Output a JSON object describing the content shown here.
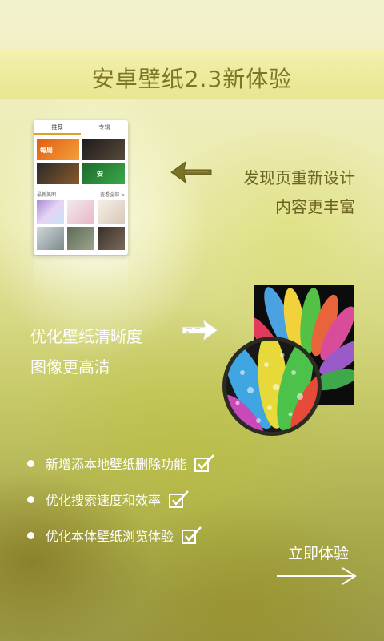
{
  "banner": {
    "title": "安卓壁纸2.3新体验"
  },
  "phone": {
    "tabs": [
      {
        "label": "推荐"
      },
      {
        "label": "专辑"
      }
    ],
    "tiles": [
      {
        "label": "每周"
      },
      {
        "label": ""
      },
      {
        "label": ""
      },
      {
        "label": "安"
      }
    ],
    "section": {
      "title": "最新美图",
      "more": "查看全部 >"
    }
  },
  "features_top": {
    "line1": "发现页重新设计",
    "line2": "内容更丰富"
  },
  "features_mid": {
    "line1": "优化壁纸清晰度",
    "line2": "图像更高清"
  },
  "features_list": [
    {
      "label": "新增添本地壁纸删除功能"
    },
    {
      "label": "优化搜索速度和效率"
    },
    {
      "label": "优化本体壁纸浏览体验"
    }
  ],
  "cta": {
    "label": "立即体验"
  },
  "colors": {
    "banner_text": "#7e7624",
    "caption_dark": "#6b6320",
    "white": "#ffffff"
  }
}
